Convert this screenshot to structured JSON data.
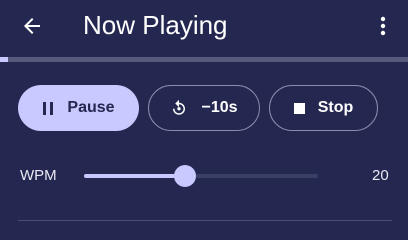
{
  "appbar": {
    "title": "Now Playing",
    "back_icon": "arrow-back-icon",
    "menu_icon": "more-vertical-icon"
  },
  "playback": {
    "progress_percent": 2
  },
  "controls": {
    "pause_label": "Pause",
    "pause_icon": "pause-icon",
    "rewind_label": "−10s",
    "rewind_icon": "replay-10-icon",
    "stop_label": "Stop",
    "stop_icon": "stop-icon"
  },
  "speed": {
    "label": "WPM",
    "value": "20",
    "slider_fraction": 0.43
  },
  "colors": {
    "background": "#242850",
    "accent": "#c8c9ff",
    "outline": "#8a8db0"
  }
}
